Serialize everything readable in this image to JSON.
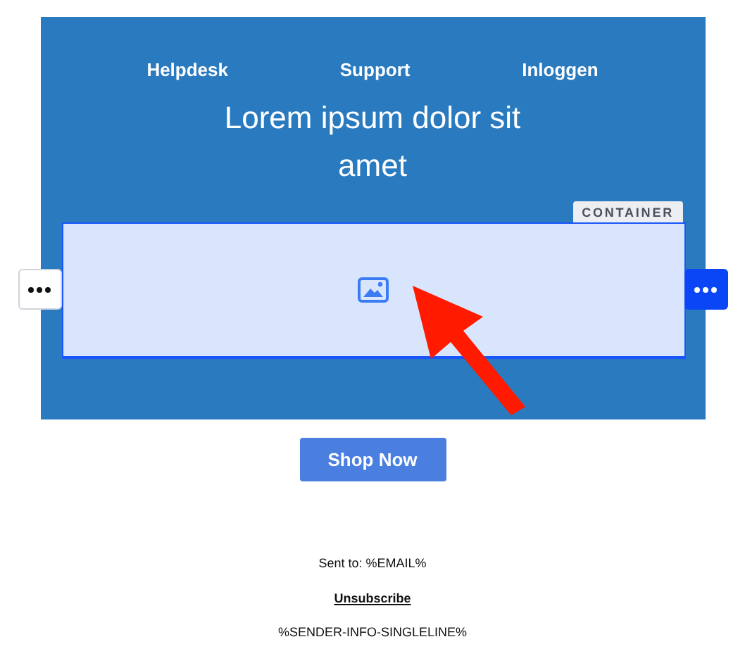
{
  "nav": [
    "Helpdesk",
    "Support",
    "Inloggen"
  ],
  "heading": "Lorem ipsum dolor sit amet",
  "container": {
    "label": "CONTAINER",
    "kind": "picture",
    "selected": true
  },
  "button": "Shop Now",
  "footer": {
    "sent_to": "Sent to: %EMAIL%",
    "unsubscribe": "Unsubscribe",
    "sender": "%SENDER-INFO-SINGLELINE%"
  }
}
